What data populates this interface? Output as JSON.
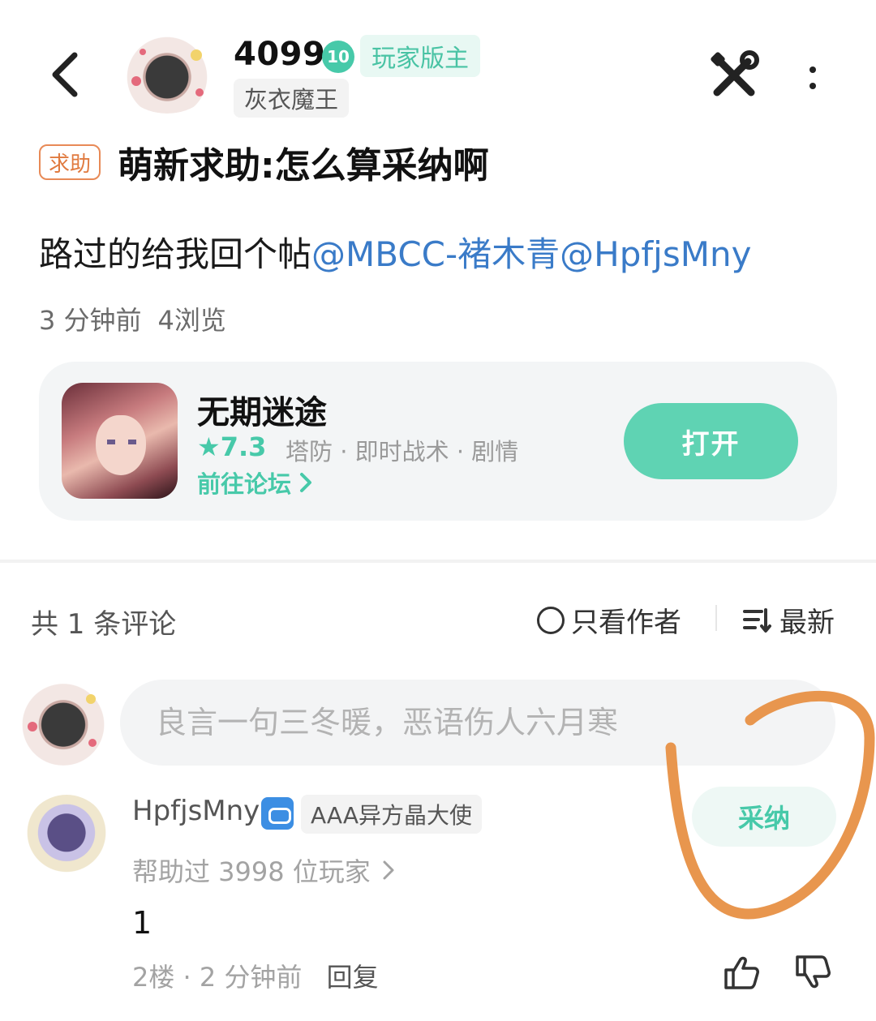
{
  "header": {
    "username": "4099",
    "level": "10",
    "role": "玩家版主",
    "title": "灰衣魔王"
  },
  "post": {
    "tag": "求助",
    "title": "萌新求助:怎么算采纳啊",
    "body_text": "路过的给我回个帖",
    "mentions": [
      "@MBCC-褚木青",
      "@HpfjsMny"
    ],
    "time": "3 分钟前",
    "views": "4浏览"
  },
  "game_card": {
    "name": "无期迷途",
    "rating": "★7.3",
    "tags": "塔防 · 即时战术 · 剧情",
    "forum_link": "前往论坛",
    "open_button": "打开"
  },
  "comments_header": {
    "count": "共 1 条评论",
    "author_only": "只看作者",
    "sort": "最新"
  },
  "comment_input": {
    "placeholder": "良言一句三冬暖，恶语伤人六月寒"
  },
  "comment": {
    "user": "HpfjsMny",
    "chip": "AAA异方晶大使",
    "accept": "采纳",
    "helped": "帮助过 3998 位玩家",
    "body": "1",
    "floor": "2楼",
    "time": "2 分钟前",
    "reply": "回复"
  },
  "icons": {
    "back": "chevron-left-icon",
    "tools": "tools-icon",
    "more": "more-vertical-icon",
    "like": "thumbs-up-icon",
    "dislike": "thumbs-down-icon",
    "sort": "sort-list-icon"
  },
  "colors": {
    "accent": "#47c9a9",
    "mention": "#3a7bc8",
    "help_tag": "#e07a3f",
    "annotation": "#e8964e"
  }
}
